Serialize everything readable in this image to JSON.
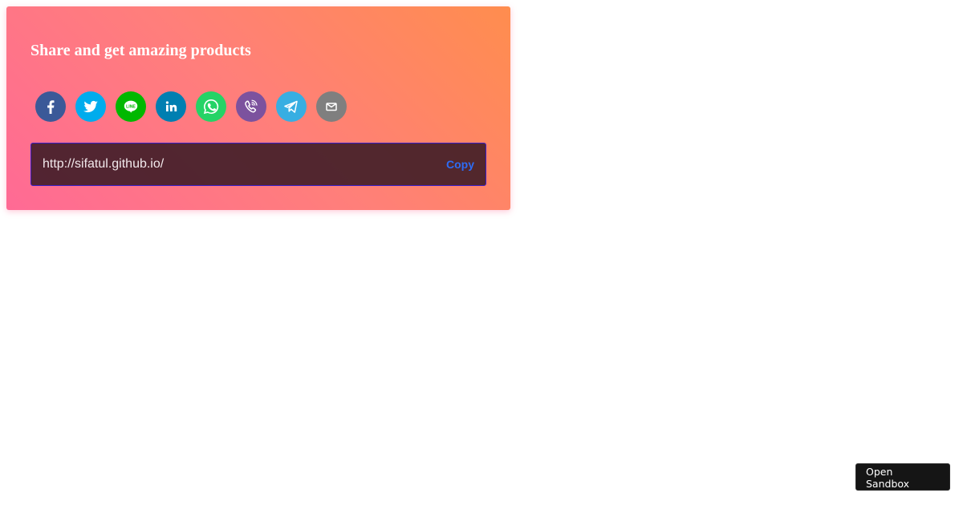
{
  "card": {
    "title": "Share and get amazing products",
    "icons": [
      {
        "name": "facebook-icon",
        "bg": "#3b5998"
      },
      {
        "name": "twitter-icon",
        "bg": "#00aced"
      },
      {
        "name": "line-icon",
        "bg": "#00b800"
      },
      {
        "name": "linkedin-icon",
        "bg": "#007fb1"
      },
      {
        "name": "whatsapp-icon",
        "bg": "#25d366"
      },
      {
        "name": "viber-icon",
        "bg": "#7c529e"
      },
      {
        "name": "telegram-icon",
        "bg": "#37aee2"
      },
      {
        "name": "email-icon",
        "bg": "#7f7f7f"
      }
    ],
    "url": "http://sifatul.github.io/",
    "copy_label": "Copy"
  },
  "sandbox": {
    "label": "Open Sandbox"
  },
  "colors": {
    "gradient_start": "#ff6a95",
    "gradient_end": "#ff8d4e",
    "url_box_border": "#3b1fc9",
    "copy_text": "#2d6cf5"
  }
}
